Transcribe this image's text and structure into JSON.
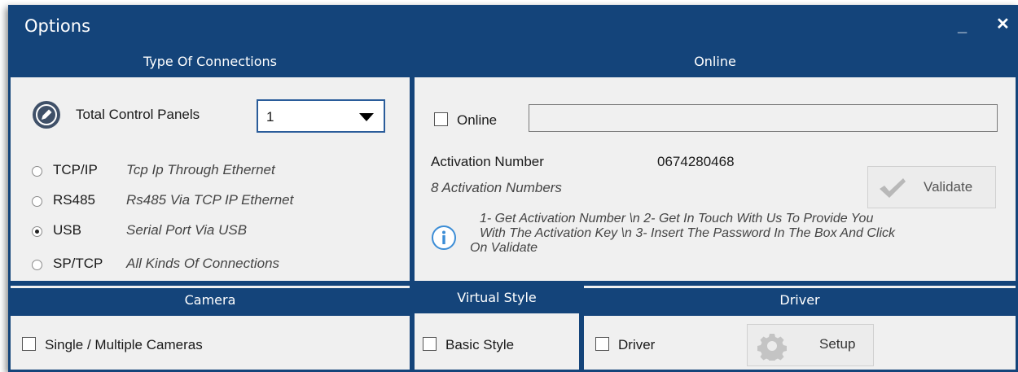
{
  "window": {
    "title": "Options",
    "minimize_glyph": "_",
    "close_glyph": "✕"
  },
  "connections": {
    "header": "Type Of Connections",
    "total_panels_label": "Total Control Panels",
    "total_panels_value": "1",
    "options": [
      {
        "label": "TCP/IP",
        "description": "Tcp Ip Through Ethernet",
        "selected": false
      },
      {
        "label": "RS485",
        "description": "Rs485 Via TCP IP Ethernet",
        "selected": false
      },
      {
        "label": "USB",
        "description": "Serial Port Via USB",
        "selected": true
      },
      {
        "label": "SP/TCP",
        "description": "All Kinds Of Connections",
        "selected": false
      }
    ]
  },
  "online": {
    "header": "Online",
    "checkbox_label": "Online",
    "input_value": "",
    "activation_label": "Activation Number",
    "activation_value": "0674280468",
    "activation_count": "8 Activation Numbers",
    "validate_label": "Validate",
    "info_line1": "1- Get Activation Number \\n 2- Get In Touch With Us To Provide You",
    "info_line2": "With The Activation Key \\n 3- Insert The Password In The Box And Click",
    "info_line3": "On Validate"
  },
  "camera": {
    "header": "Camera",
    "checkbox_label": "Single / Multiple Cameras"
  },
  "virtual_style": {
    "header": "Virtual Style",
    "checkbox_label": "Basic Style"
  },
  "driver": {
    "header": "Driver",
    "checkbox_label": "Driver",
    "setup_label": "Setup"
  },
  "colors": {
    "accent": "#14447a",
    "panel_bg": "#f0f0f0",
    "info_icon": "#3c8dd6"
  },
  "icons": [
    "edit-pencil-icon",
    "checkmark-icon",
    "info-icon",
    "gear-icon"
  ]
}
